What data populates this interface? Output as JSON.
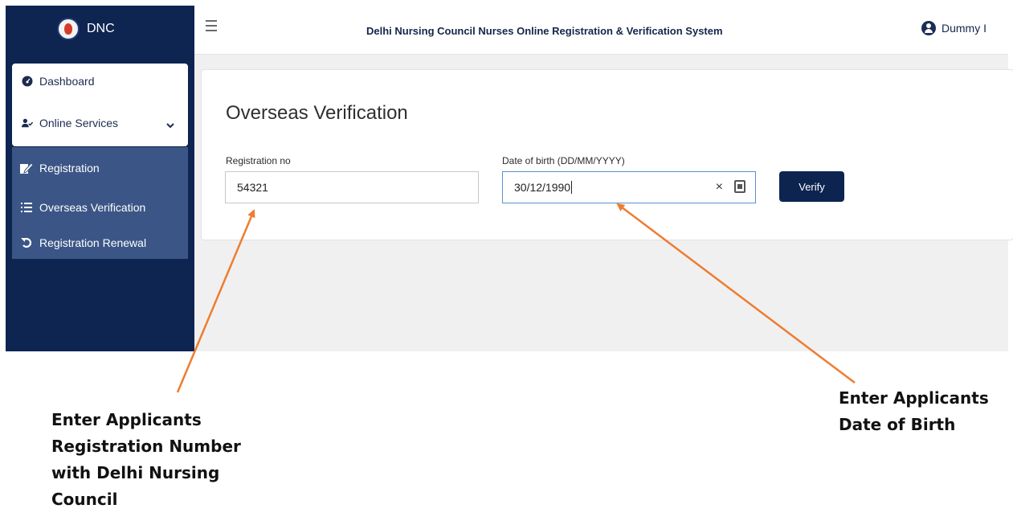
{
  "brand": {
    "name": "DNC"
  },
  "header": {
    "title": "Delhi Nursing Council Nurses Online Registration & Verification System",
    "user_name": "Dummy I"
  },
  "sidebar": {
    "items": [
      {
        "label": "Dashboard",
        "icon": "dashboard-icon"
      },
      {
        "label": "Online Services",
        "icon": "user-check-icon"
      }
    ],
    "submenu": [
      {
        "label": "Registration",
        "icon": "edit-icon"
      },
      {
        "label": "Overseas Verification",
        "icon": "list-icon"
      },
      {
        "label": "Registration Renewal",
        "icon": "undo-icon"
      }
    ]
  },
  "main": {
    "page_title": "Overseas Verification",
    "registration_label": "Registration no",
    "registration_value": "54321",
    "dob_label": "Date of birth (DD/MM/YYYY)",
    "dob_value": "30/12/1990",
    "verify_label": "Verify"
  },
  "annotations": {
    "left": [
      "Enter Applicants",
      "Registration Number",
      "with Delhi Nursing",
      "Council"
    ],
    "right": [
      "Enter Applicants",
      "Date of Birth"
    ],
    "arrow_color": "#ed7d31"
  }
}
